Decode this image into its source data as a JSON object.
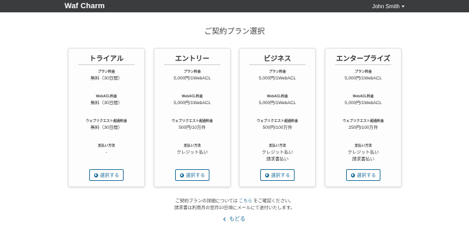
{
  "navbar": {
    "brand": "Waf Charm",
    "user_name": "John Smith"
  },
  "page": {
    "title": "ご契約プラン選択"
  },
  "plans": [
    {
      "name": "トライアル",
      "plan_fee_label": "プラン料金",
      "plan_fee": "無料（30日間）",
      "webacl_fee_label": "WebACL料金",
      "webacl_fee": "無料（30日間）",
      "overage_label": "ウェブリクエスト超過料金",
      "overage": "無料（30日間）",
      "payment_label": "支払い方法",
      "payment_1": "-",
      "payment_2": "",
      "select_label": "選択する"
    },
    {
      "name": "エントリー",
      "plan_fee_label": "プラン料金",
      "plan_fee": "5,000円/1WebACL",
      "webacl_fee_label": "WebACL料金",
      "webacl_fee": "5,000円/1WebACL",
      "overage_label": "ウェブリクエスト超過料金",
      "overage": "500円/10万件",
      "payment_label": "支払い方法",
      "payment_1": "クレジット払い",
      "payment_2": "",
      "select_label": "選択する"
    },
    {
      "name": "ビジネス",
      "plan_fee_label": "プラン料金",
      "plan_fee": "5,000円/1WebACL",
      "webacl_fee_label": "WebACL料金",
      "webacl_fee": "5,000円/1WebACL",
      "overage_label": "ウェブリクエスト超過料金",
      "overage": "500円/100万件",
      "payment_label": "支払い方法",
      "payment_1": "クレジット払い",
      "payment_2": "請求書払い",
      "select_label": "選択する"
    },
    {
      "name": "エンタープライズ",
      "plan_fee_label": "プラン料金",
      "plan_fee": "5,000円/1WebACL",
      "webacl_fee_label": "WebACL料金",
      "webacl_fee": "5,000円/1WebACL",
      "overage_label": "ウェブリクエスト超過料金",
      "overage": "250円/100万件",
      "payment_label": "支払い方法",
      "payment_1": "クレジット払い",
      "payment_2": "請求書払い",
      "select_label": "選択する"
    }
  ],
  "footer": {
    "details_prefix": "ご契約プランの詳細については ",
    "details_link": "こちら",
    "details_suffix": " をご確認ください。",
    "billing_note": "請求書は利用月の翌月10日頃にメールにて送付いたします。",
    "back_label": "もどる"
  },
  "colors": {
    "navbar_bg": "#3a3c3e",
    "accent": "#1f6f9b"
  }
}
